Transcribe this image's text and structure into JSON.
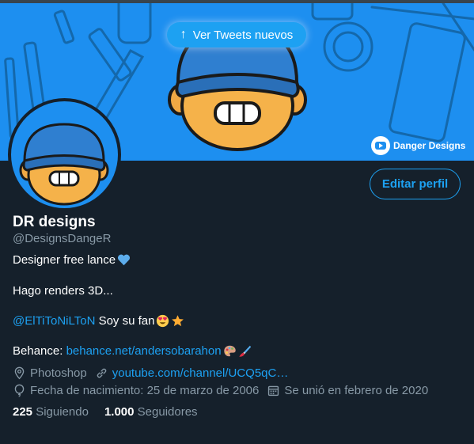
{
  "banner": {
    "new_tweets_label": "Ver Tweets nuevos",
    "brand_name": "Danger Designs",
    "bg_color": "#1d8ff0"
  },
  "profile": {
    "name": "DR designs",
    "handle": "@DesignsDangeR",
    "edit_button": "Editar perfil",
    "bio": {
      "line1": "Designer free lance",
      "line2": "Hago renders 3D...",
      "mention": "@ElTiToNiLToN",
      "mention_suffix": " Soy su fan",
      "behance_prefix": "Behance: ",
      "behance_link": "behance.net/andersobarahon"
    },
    "location": "Photoshop",
    "website": "youtube.com/channel/UCQ5qC…",
    "birthday": "Fecha de nacimiento: 25 de marzo de 2006",
    "joined": "Se unió en febrero de 2020",
    "following_count": "225",
    "following_label": "Siguiendo",
    "followers_count": "1.000",
    "followers_label": "Seguidores"
  },
  "colors": {
    "background": "#15202b",
    "accent": "#1da1f2",
    "muted": "#8899a6"
  },
  "icons": [
    "arrow-up-icon",
    "youtube-icon",
    "blue-heart-icon",
    "heart-eyes-emoji-icon",
    "star-icon",
    "palette-icon",
    "paintbrush-icon",
    "location-icon",
    "link-icon",
    "balloon-icon",
    "calendar-icon"
  ]
}
